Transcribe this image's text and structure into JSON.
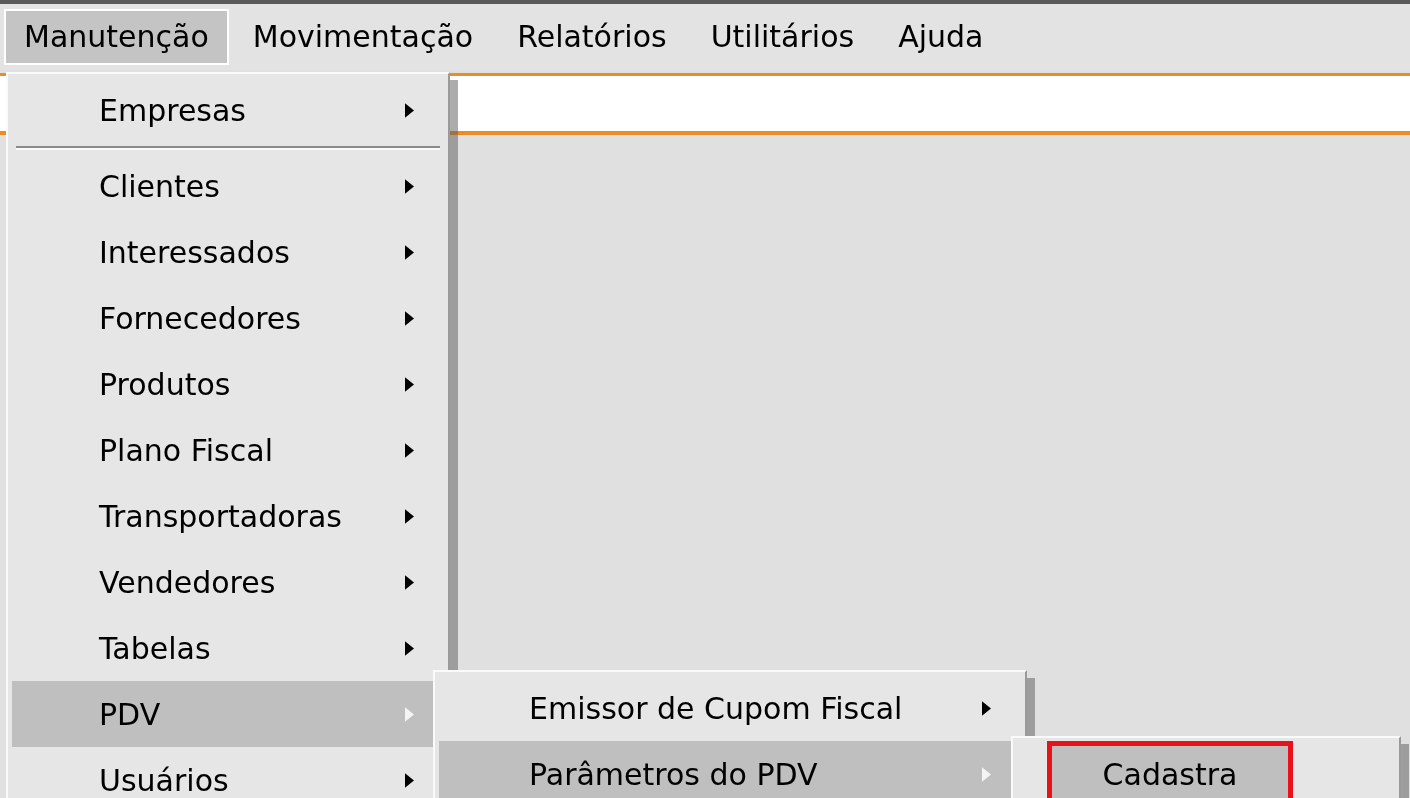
{
  "menu_bar": [
    {
      "label": "Manutenção",
      "selected": true
    },
    {
      "label": "Movimentação",
      "selected": false
    },
    {
      "label": "Relatórios",
      "selected": false
    },
    {
      "label": "Utilitários",
      "selected": false
    },
    {
      "label": "Ajuda",
      "selected": false
    }
  ],
  "menus": [
    {
      "items": [
        {
          "kind": "item",
          "label": "Empresas",
          "has_submenu": true,
          "selected": false
        },
        {
          "kind": "separator"
        },
        {
          "kind": "item",
          "label": "Clientes",
          "has_submenu": true,
          "selected": false
        },
        {
          "kind": "item",
          "label": "Interessados",
          "has_submenu": true,
          "selected": false
        },
        {
          "kind": "item",
          "label": "Fornecedores",
          "has_submenu": true,
          "selected": false
        },
        {
          "kind": "item",
          "label": "Produtos",
          "has_submenu": true,
          "selected": false
        },
        {
          "kind": "item",
          "label": "Plano Fiscal",
          "has_submenu": true,
          "selected": false
        },
        {
          "kind": "item",
          "label": "Transportadoras",
          "has_submenu": true,
          "selected": false
        },
        {
          "kind": "item",
          "label": "Vendedores",
          "has_submenu": true,
          "selected": false
        },
        {
          "kind": "item",
          "label": "Tabelas",
          "has_submenu": true,
          "selected": false
        },
        {
          "kind": "item",
          "label": "PDV",
          "has_submenu": true,
          "selected": true
        },
        {
          "kind": "item",
          "label": "Usuários",
          "has_submenu": true,
          "selected": false
        }
      ]
    },
    {
      "items": [
        {
          "kind": "item",
          "label": "Emissor de Cupom Fiscal",
          "has_submenu": true,
          "selected": false
        },
        {
          "kind": "item",
          "label": "Parâmetros do PDV",
          "has_submenu": true,
          "selected": true
        }
      ]
    },
    {
      "items": [
        {
          "kind": "item",
          "label": "Cadastra",
          "has_submenu": false,
          "selected": true,
          "highlighted_box": true
        }
      ]
    }
  ]
}
